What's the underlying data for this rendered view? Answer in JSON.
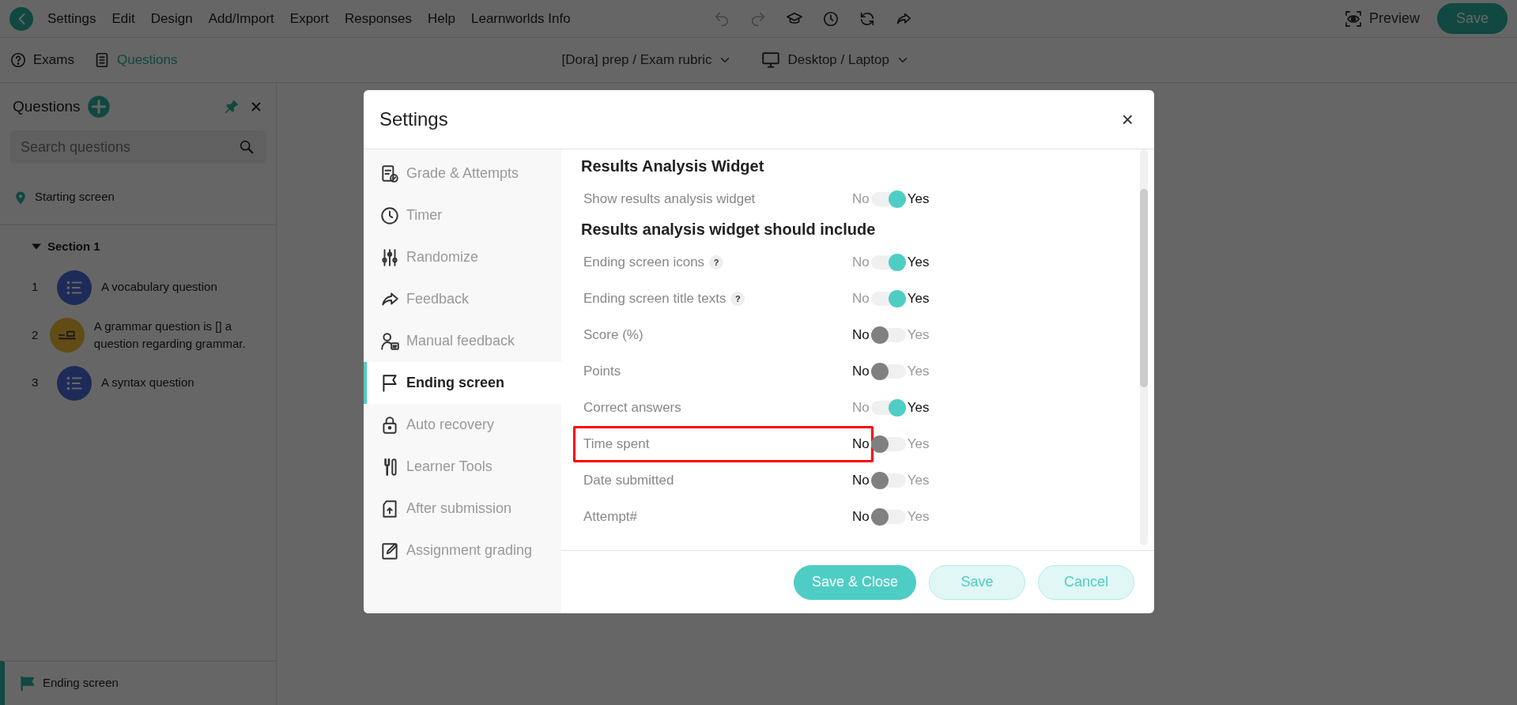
{
  "menu_bar": {
    "items": [
      "Settings",
      "Edit",
      "Design",
      "Add/Import",
      "Export",
      "Responses",
      "Help",
      "Learnworlds Info"
    ],
    "preview": "Preview",
    "save": "Save"
  },
  "toolbar": {
    "tabs": [
      {
        "label": "Exams",
        "selected": false
      },
      {
        "label": "Questions",
        "selected": true
      }
    ],
    "exam_selector": "[Dora] prep / Exam rubric",
    "device_selector": "Desktop / Laptop"
  },
  "sidebar": {
    "title": "Questions",
    "search": {
      "placeholder": "Search questions"
    },
    "starting_screen": "Starting screen",
    "sections": [
      {
        "label": "Section 1",
        "expanded": true,
        "children": [
          {
            "number": "1",
            "text": "A vocabulary question",
            "kind": "list"
          },
          {
            "number": "2",
            "text": "A grammar question is [] a question regarding grammar.",
            "kind": "fill"
          },
          {
            "number": "3",
            "text": "A syntax question",
            "kind": "list"
          }
        ]
      }
    ],
    "ending_screen": {
      "label": "Ending screen",
      "selected": true
    }
  },
  "modal": {
    "title": "Settings",
    "close": "×",
    "nav": [
      {
        "label": "Grade & Attempts",
        "selected": false
      },
      {
        "label": "Timer",
        "selected": false
      },
      {
        "label": "Randomize",
        "selected": false
      },
      {
        "label": "Feedback",
        "selected": false
      },
      {
        "label": "Manual feedback",
        "selected": false
      },
      {
        "label": "Ending screen",
        "selected": true
      },
      {
        "label": "Auto recovery",
        "selected": false
      },
      {
        "label": "Learner Tools",
        "selected": false
      },
      {
        "label": "After submission",
        "selected": false
      },
      {
        "label": "Assignment grading",
        "selected": false
      }
    ],
    "sections": [
      {
        "heading": "Results Analysis Widget",
        "rows": [
          {
            "label": "Show results analysis widget",
            "help": false,
            "off_label": "No",
            "on_label": "Yes",
            "on": true,
            "highlighted": false
          }
        ]
      },
      {
        "heading": "Results analysis widget should include",
        "rows": [
          {
            "label": "Ending screen icons",
            "help": true,
            "off_label": "No",
            "on_label": "Yes",
            "on": true,
            "highlighted": false
          },
          {
            "label": "Ending screen title texts",
            "help": true,
            "off_label": "No",
            "on_label": "Yes",
            "on": true,
            "highlighted": false
          },
          {
            "label": "Score (%)",
            "help": false,
            "off_label": "No",
            "on_label": "Yes",
            "on": false,
            "highlighted": false
          },
          {
            "label": "Points",
            "help": false,
            "off_label": "No",
            "on_label": "Yes",
            "on": false,
            "highlighted": false
          },
          {
            "label": "Correct answers",
            "help": false,
            "off_label": "No",
            "on_label": "Yes",
            "on": true,
            "highlighted": false
          },
          {
            "label": "Time spent",
            "help": false,
            "off_label": "No",
            "on_label": "Yes",
            "on": false,
            "highlighted": true
          },
          {
            "label": "Date submitted",
            "help": false,
            "off_label": "No",
            "on_label": "Yes",
            "on": false,
            "highlighted": false
          },
          {
            "label": "Attempt#",
            "help": false,
            "off_label": "No",
            "on_label": "Yes",
            "on": false,
            "highlighted": false
          }
        ]
      }
    ],
    "help_mark": "?",
    "buttons": [
      {
        "label": "Save & Close",
        "kind": "primary"
      },
      {
        "label": "Save",
        "kind": "secondary"
      },
      {
        "label": "Cancel",
        "kind": "secondary"
      }
    ]
  }
}
